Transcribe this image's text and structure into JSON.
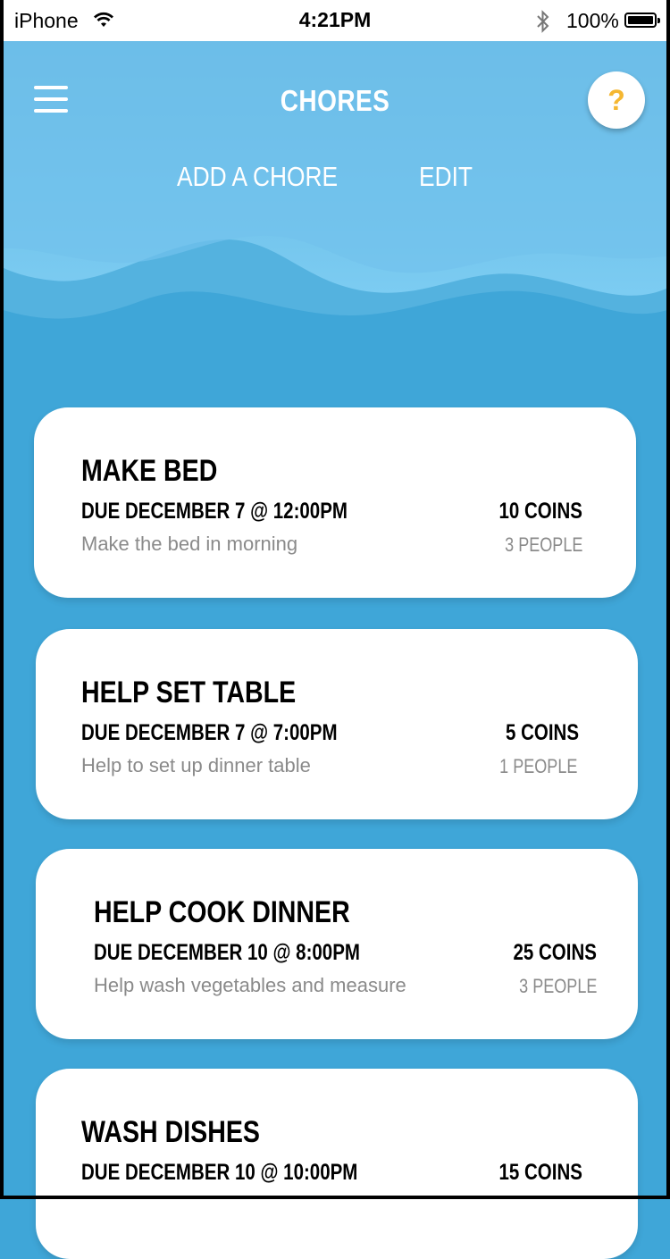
{
  "status_bar": {
    "carrier": "iPhone",
    "time": "4:21PM",
    "battery": "100%"
  },
  "header": {
    "title": "CHORES",
    "help_label": "?",
    "add_label": "ADD A CHORE",
    "edit_label": "EDIT"
  },
  "chores": [
    {
      "name": "MAKE BED",
      "due": "DUE DECEMBER 7 @ 12:00PM",
      "description": "Make the bed in morning",
      "coins": "10 COINS",
      "people": "3 PEOPLE"
    },
    {
      "name": "HELP SET TABLE",
      "due": "DUE DECEMBER 7 @ 7:00PM",
      "description": "Help to set up dinner table",
      "coins": "5 COINS",
      "people": "1 PEOPLE"
    },
    {
      "name": "HELP COOK DINNER",
      "due": "DUE DECEMBER 10 @ 8:00PM",
      "description": "Help wash vegetables and measure",
      "coins": "25 COINS",
      "people": "3 PEOPLE"
    },
    {
      "name": "WASH DISHES",
      "due": "DUE DECEMBER 10 @ 10:00PM",
      "description": "",
      "coins": "15 COINS",
      "people": ""
    }
  ],
  "colors": {
    "background": "#3fa6d8",
    "wave_light": "#7cccf2",
    "accent_help": "#f5b731"
  }
}
